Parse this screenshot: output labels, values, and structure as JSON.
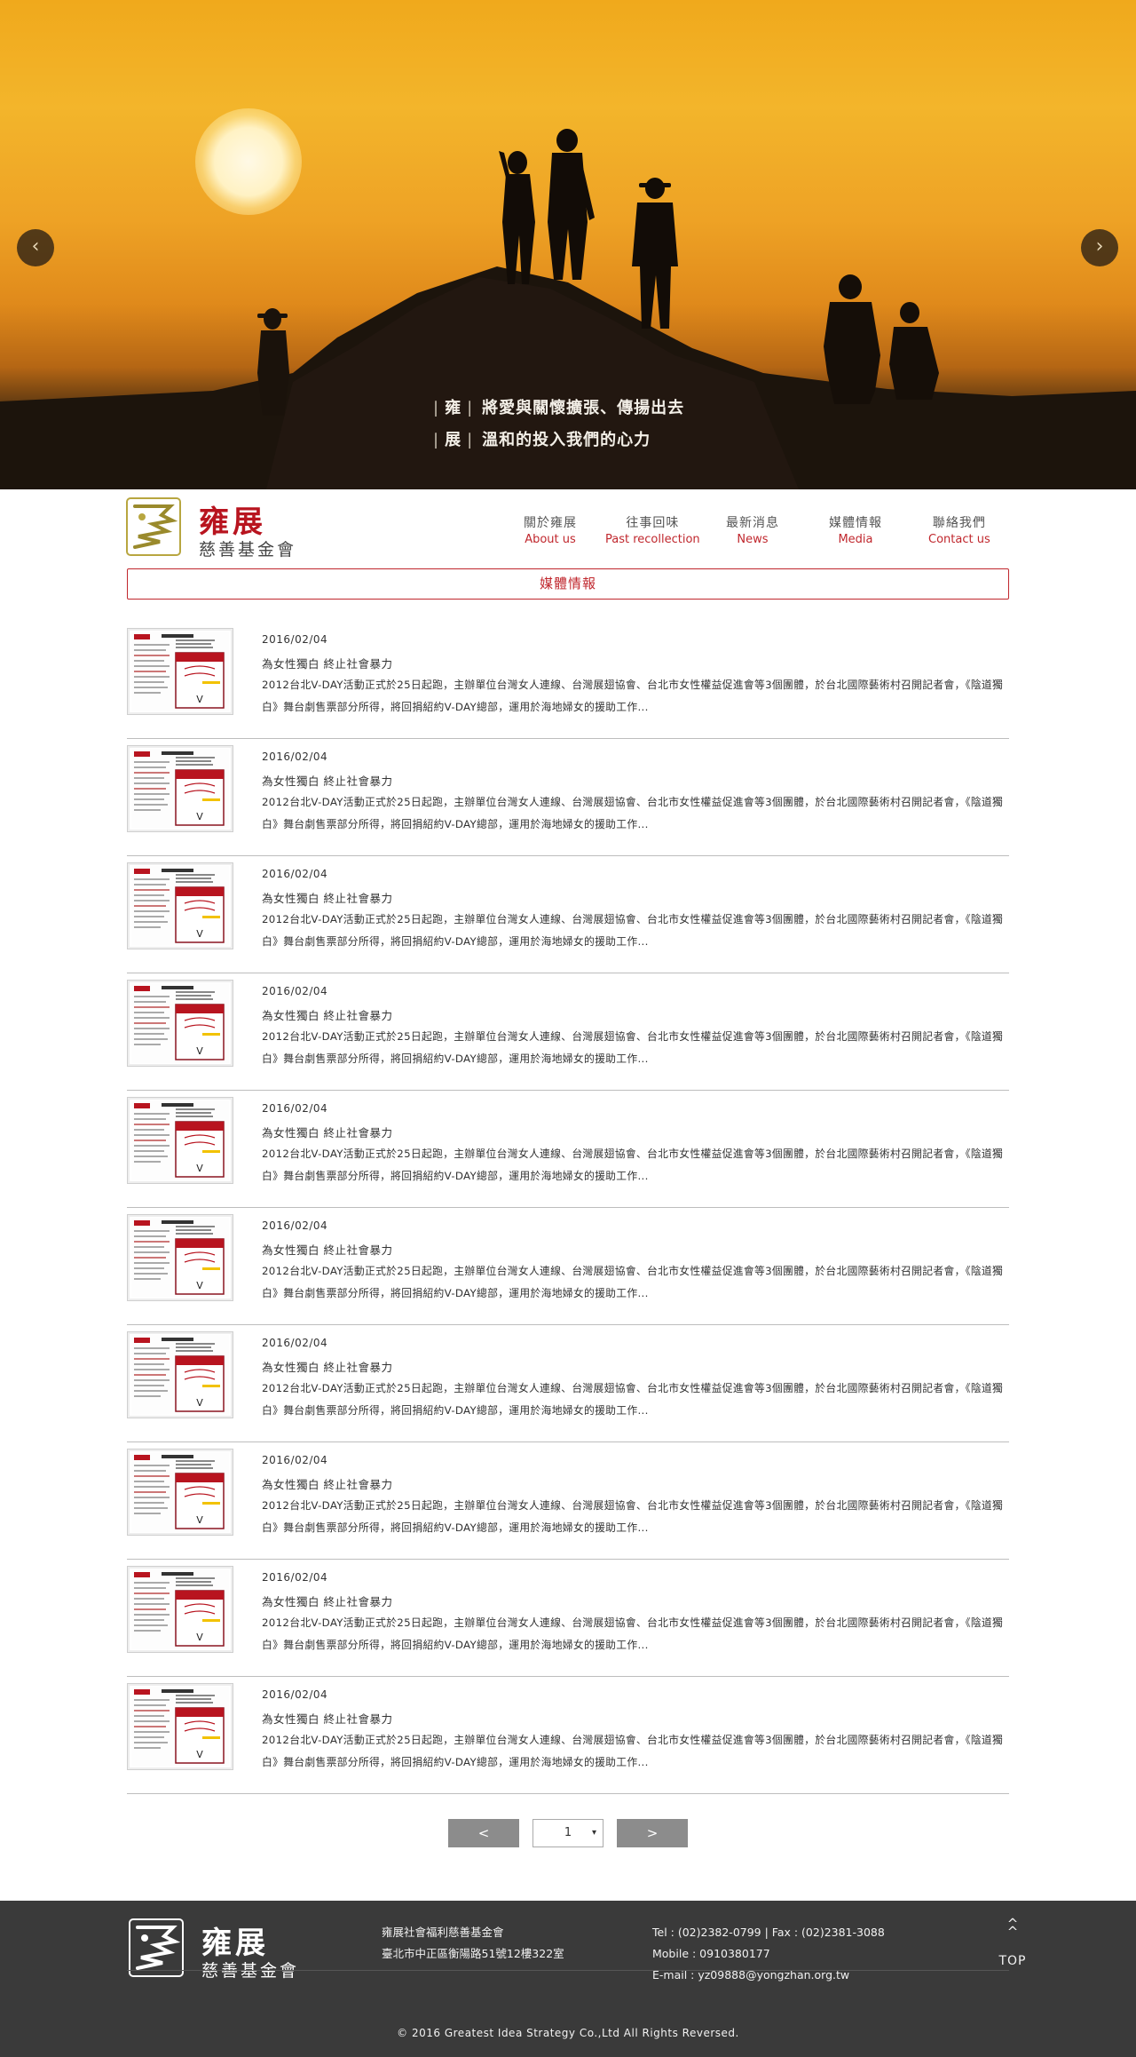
{
  "hero": {
    "prev_glyph": "‹",
    "next_glyph": "›",
    "slogan": [
      {
        "char": "雍",
        "text": "將愛與關懷擴張、傳揚出去"
      },
      {
        "char": "展",
        "text": "溫和的投入我們的心力"
      }
    ]
  },
  "brand": {
    "name": "雍展",
    "subtitle": "慈善基金會",
    "color": "#b8141f"
  },
  "nav": [
    {
      "zh": "關於雍展",
      "en": "About us"
    },
    {
      "zh": "往事回味",
      "en": "Past recollection"
    },
    {
      "zh": "最新消息",
      "en": "News"
    },
    {
      "zh": "媒體情報",
      "en": "Media"
    },
    {
      "zh": "聯絡我們",
      "en": "Contact us"
    }
  ],
  "section": {
    "title": "媒體情報"
  },
  "articles": [
    {
      "date": "2016/02/04",
      "title": "為女性獨白 終止社會暴力",
      "desc": "2012台北V-DAY活動正式於25日起跑，主辦單位台灣女人連線、台灣展翅協會、台北市女性權益促進會等3個團體，於台北國際藝術村召開記者會，《陰道獨白》舞台劇售票部分所得，將回捐紹約V-DAY總部，運用於海地婦女的援助工作..."
    },
    {
      "date": "2016/02/04",
      "title": "為女性獨白 終止社會暴力",
      "desc": "2012台北V-DAY活動正式於25日起跑，主辦單位台灣女人連線、台灣展翅協會、台北市女性權益促進會等3個團體，於台北國際藝術村召開記者會，《陰道獨白》舞台劇售票部分所得，將回捐紹約V-DAY總部，運用於海地婦女的援助工作..."
    },
    {
      "date": "2016/02/04",
      "title": "為女性獨白 終止社會暴力",
      "desc": "2012台北V-DAY活動正式於25日起跑，主辦單位台灣女人連線、台灣展翅協會、台北市女性權益促進會等3個團體，於台北國際藝術村召開記者會，《陰道獨白》舞台劇售票部分所得，將回捐紹約V-DAY總部，運用於海地婦女的援助工作..."
    },
    {
      "date": "2016/02/04",
      "title": "為女性獨白 終止社會暴力",
      "desc": "2012台北V-DAY活動正式於25日起跑，主辦單位台灣女人連線、台灣展翅協會、台北市女性權益促進會等3個團體，於台北國際藝術村召開記者會，《陰道獨白》舞台劇售票部分所得，將回捐紹約V-DAY總部，運用於海地婦女的援助工作..."
    },
    {
      "date": "2016/02/04",
      "title": "為女性獨白 終止社會暴力",
      "desc": "2012台北V-DAY活動正式於25日起跑，主辦單位台灣女人連線、台灣展翅協會、台北市女性權益促進會等3個團體，於台北國際藝術村召開記者會，《陰道獨白》舞台劇售票部分所得，將回捐紹約V-DAY總部，運用於海地婦女的援助工作..."
    },
    {
      "date": "2016/02/04",
      "title": "為女性獨白 終止社會暴力",
      "desc": "2012台北V-DAY活動正式於25日起跑，主辦單位台灣女人連線、台灣展翅協會、台北市女性權益促進會等3個團體，於台北國際藝術村召開記者會，《陰道獨白》舞台劇售票部分所得，將回捐紹約V-DAY總部，運用於海地婦女的援助工作..."
    },
    {
      "date": "2016/02/04",
      "title": "為女性獨白 終止社會暴力",
      "desc": "2012台北V-DAY活動正式於25日起跑，主辦單位台灣女人連線、台灣展翅協會、台北市女性權益促進會等3個團體，於台北國際藝術村召開記者會，《陰道獨白》舞台劇售票部分所得，將回捐紹約V-DAY總部，運用於海地婦女的援助工作..."
    },
    {
      "date": "2016/02/04",
      "title": "為女性獨白 終止社會暴力",
      "desc": "2012台北V-DAY活動正式於25日起跑，主辦單位台灣女人連線、台灣展翅協會、台北市女性權益促進會等3個團體，於台北國際藝術村召開記者會，《陰道獨白》舞台劇售票部分所得，將回捐紹約V-DAY總部，運用於海地婦女的援助工作..."
    },
    {
      "date": "2016/02/04",
      "title": "為女性獨白 終止社會暴力",
      "desc": "2012台北V-DAY活動正式於25日起跑，主辦單位台灣女人連線、台灣展翅協會、台北市女性權益促進會等3個團體，於台北國際藝術村召開記者會，《陰道獨白》舞台劇售票部分所得，將回捐紹約V-DAY總部，運用於海地婦女的援助工作..."
    },
    {
      "date": "2016/02/04",
      "title": "為女性獨白 終止社會暴力",
      "desc": "2012台北V-DAY活動正式於25日起跑，主辦單位台灣女人連線、台灣展翅協會、台北市女性權益促進會等3個團體，於台北國際藝術村召開記者會，《陰道獨白》舞台劇售票部分所得，將回捐紹約V-DAY總部，運用於海地婦女的援助工作..."
    }
  ],
  "pager": {
    "prev_label": "<",
    "next_label": ">",
    "current_page": "1",
    "dropdown_arrow": "▾"
  },
  "footer": {
    "org_name": "雍展社會福利慈善基金會",
    "address": "臺北市中正區衡陽路51號12樓322室",
    "tel_line": "Tel : (02)2382-0799 | Fax : (02)2381-3088",
    "mobile_line": "Mobile : 0910380177",
    "email_line": "E-mail : yz09888@yongzhan.org.tw",
    "top_chevron": "^",
    "top_label": "TOP",
    "copyright": "© 2016 Greatest Idea Strategy Co.,Ltd All Rights Reversed."
  },
  "colors": {
    "accent": "#c0272d",
    "footer_bg": "#3a3a3a",
    "pager_button": "#8c8c8c"
  }
}
